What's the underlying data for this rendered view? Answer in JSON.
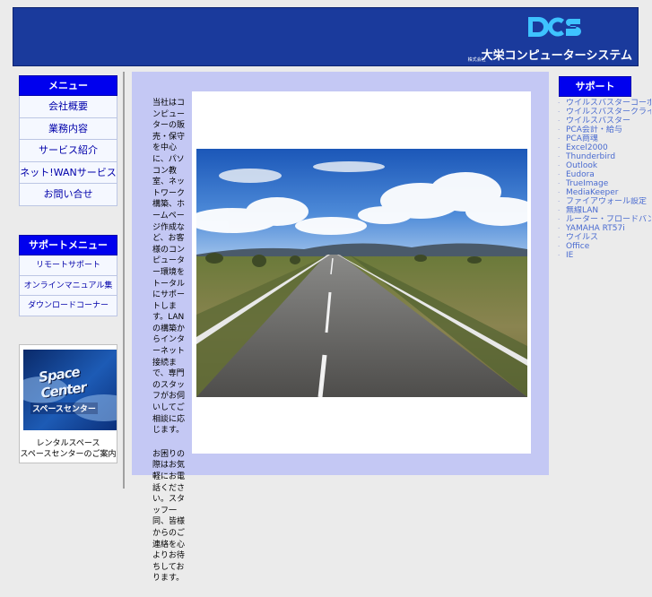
{
  "header": {
    "logo_abbrev": "DCS",
    "kabushiki": "株式会社",
    "company_name": "大栄コンピューターシステム"
  },
  "left_menu": {
    "heading": "メニュー",
    "items": [
      "会社概要",
      "業務内容",
      "サービス紹介",
      "ネット!WANサービス",
      "お問い合せ"
    ]
  },
  "left_menu2": {
    "heading": "サポートメニュー",
    "items": [
      "リモートサポート",
      "オンラインマニュアル集",
      "ダウンロードコーナー"
    ]
  },
  "banner": {
    "title": "Space Center",
    "kana": "スペースセンター",
    "caption": [
      "レンタルスペース",
      "スペースセンターのご案内"
    ]
  },
  "center": {
    "paragraphs": [
      "当社はコンピューターの販売・保守を中心に、パソコン教室、ネットワーク構築、ホームページ作成など、お客様のコンピューター環境をトータルにサポートします。LANの構築からインターネット接続まで、専門のスタッフがお伺いしてご相談に応じます。",
      "お困りの際はお気軽にお電話ください。スタッフ一同、皆様からのご連絡を心よりお待ちしております。"
    ]
  },
  "right_menu": {
    "heading": "サポート",
    "items": [
      "ウイルスバスターコーポレート",
      "ウイルスバスタークライアント",
      "ウイルスバスター",
      "PCA会計・給与",
      "PCA商魂",
      "Excel2000",
      "Thunderbird",
      "Outlook",
      "Eudora",
      "TrueImage",
      "MediaKeeper",
      "ファイアウォール設定",
      "無線LAN",
      "ルーター・ブロードバンド",
      "YAMAHA RT57i",
      "ウイルス",
      "Office",
      "IE"
    ]
  },
  "colors": {
    "header_bg": "#1a3a9c",
    "menu_head": "#0000ee",
    "center_panel": "#c4c8f4",
    "link": "#4a6bd0"
  }
}
